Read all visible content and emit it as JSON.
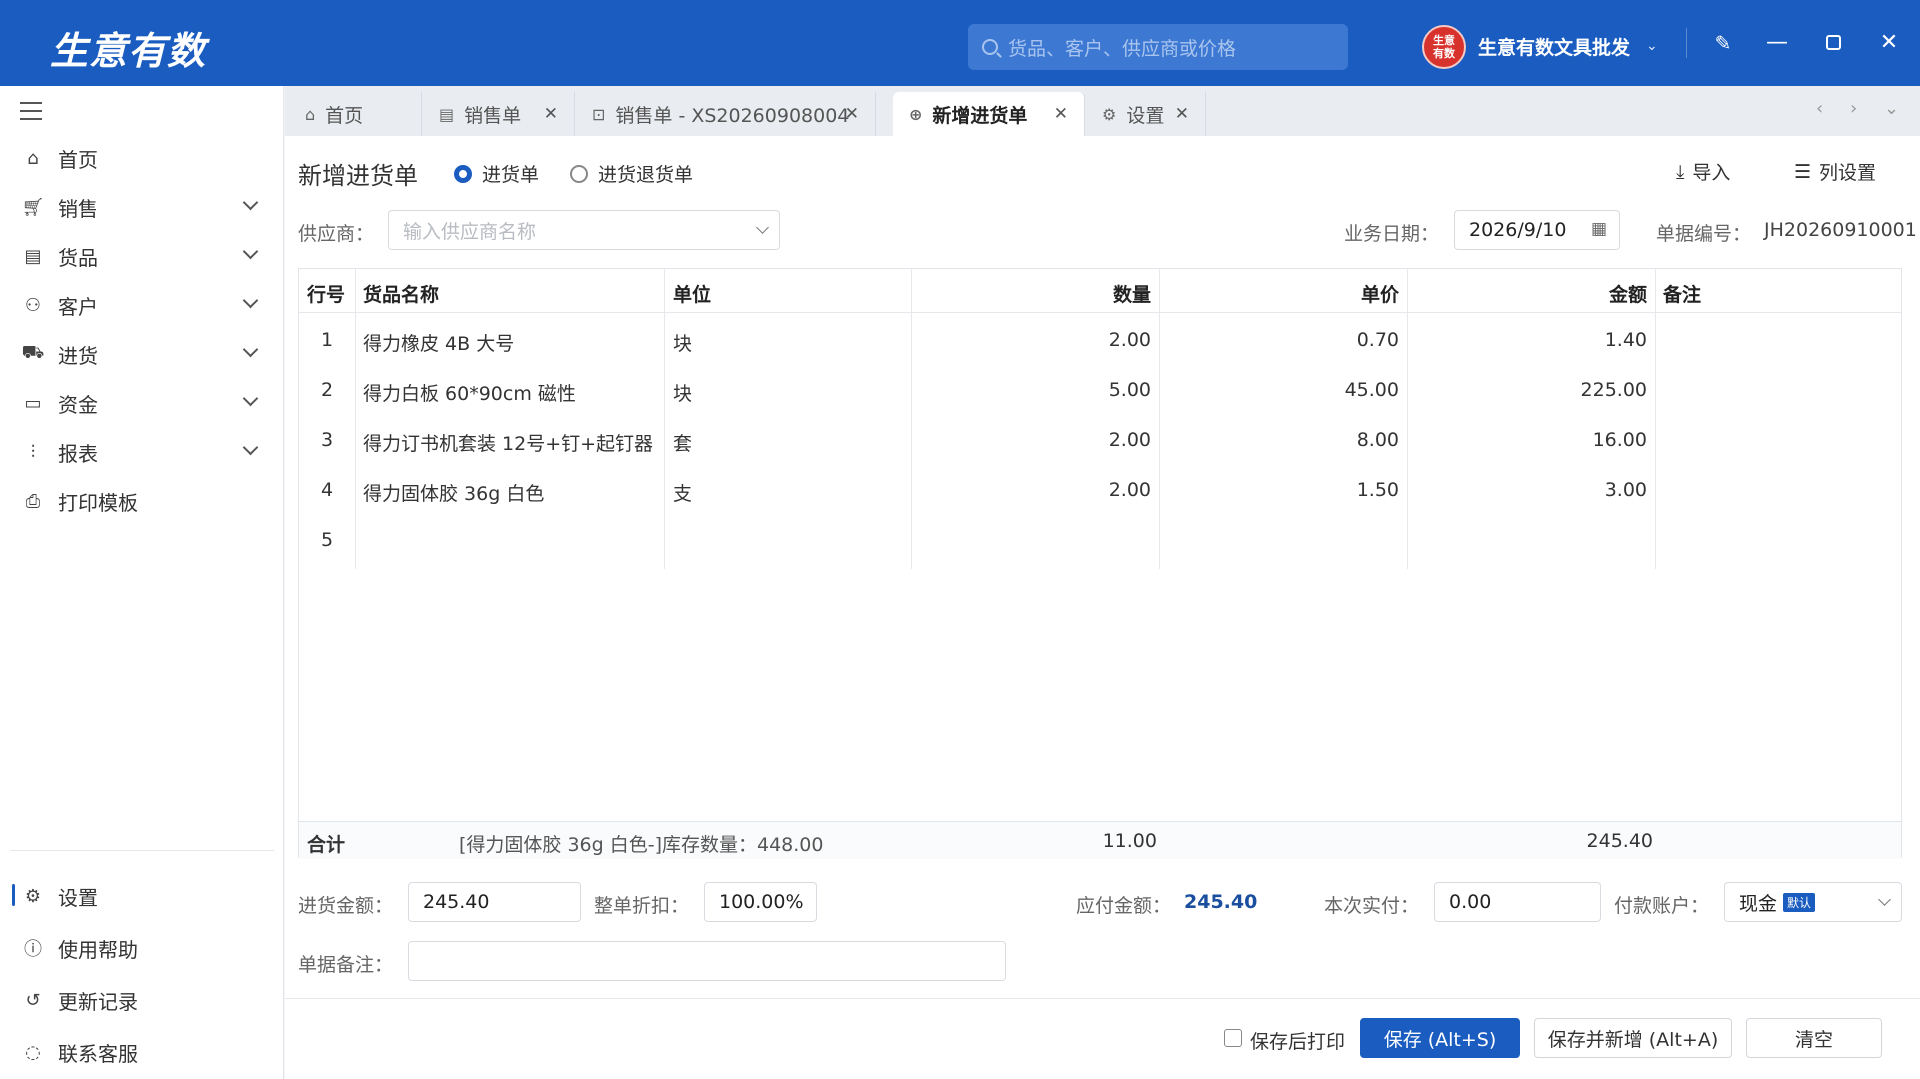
{
  "app": {
    "logo": "生意有数",
    "search_placeholder": "货品、客户、供应商或价格",
    "shop_badge": "生意\n有数",
    "shop_name": "生意有数文具批发"
  },
  "sidebar": {
    "items": [
      {
        "label": "首页",
        "icon": "home-icon"
      },
      {
        "label": "销售",
        "icon": "cart-icon"
      },
      {
        "label": "货品",
        "icon": "goods-icon"
      },
      {
        "label": "客户",
        "icon": "users-icon"
      },
      {
        "label": "进货",
        "icon": "truck-icon"
      },
      {
        "label": "资金",
        "icon": "wallet-icon"
      },
      {
        "label": "报表",
        "icon": "chart-icon"
      },
      {
        "label": "打印模板",
        "icon": "printer-icon"
      }
    ],
    "bottom": [
      {
        "label": "设置",
        "icon": "gear-icon"
      },
      {
        "label": "使用帮助",
        "icon": "help-icon"
      },
      {
        "label": "更新记录",
        "icon": "history-icon"
      },
      {
        "label": "联系客服",
        "icon": "chat-icon"
      }
    ]
  },
  "tabs": [
    {
      "label": "首页"
    },
    {
      "label": "销售单"
    },
    {
      "label": "销售单 - XS20260908004"
    },
    {
      "label": "新增进货单"
    },
    {
      "label": "设置"
    }
  ],
  "form": {
    "title": "新增进货单",
    "radio_purchase": "进货单",
    "radio_return": "进货退货单",
    "import_label": "导入",
    "columns_label": "列设置",
    "supplier_label": "供应商：",
    "supplier_placeholder": "输入供应商名称",
    "date_label": "业务日期：",
    "date_value": "2026/9/10",
    "docno_label": "单据编号：",
    "docno_value": "JH20260910001"
  },
  "table": {
    "headers": [
      "行号",
      "货品名称",
      "单位",
      "数量",
      "单价",
      "金额",
      "备注"
    ],
    "rows": [
      {
        "no": "1",
        "name": "得力橡皮 4B 大号",
        "unit": "块",
        "qty": "2.00",
        "price": "0.70",
        "amount": "1.40"
      },
      {
        "no": "2",
        "name": "得力白板 60*90cm 磁性",
        "unit": "块",
        "qty": "5.00",
        "price": "45.00",
        "amount": "225.00"
      },
      {
        "no": "3",
        "name": "得力订书机套装 12号+钉+起钉器",
        "unit": "套",
        "qty": "2.00",
        "price": "8.00",
        "amount": "16.00"
      },
      {
        "no": "4",
        "name": "得力固体胶 36g 白色",
        "unit": "支",
        "qty": "2.00",
        "price": "1.50",
        "amount": "3.00"
      },
      {
        "no": "5",
        "name": "",
        "unit": "",
        "qty": "",
        "price": "",
        "amount": ""
      }
    ],
    "total_label": "合计",
    "stock_note": "[得力固体胶 36g 白色-]库存数量：448.00",
    "total_qty": "11.00",
    "total_amount": "245.40"
  },
  "summary": {
    "purchase_amount_label": "进货金额：",
    "purchase_amount": "245.40",
    "discount_label": "整单折扣：",
    "discount": "100.00%",
    "payable_label": "应付金额：",
    "payable": "245.40",
    "paid_label": "本次实付：",
    "paid": "0.00",
    "account_label": "付款账户：",
    "account": "现金",
    "account_tag": "默认",
    "remark_label": "单据备注："
  },
  "actions": {
    "print_after_save": "保存后打印",
    "save": "保存 (Alt+S)",
    "save_new": "保存并新增 (Alt+A)",
    "clear": "清空"
  },
  "colors": {
    "brand": "#1a5cc0",
    "logo_badge": "#d8322d"
  }
}
